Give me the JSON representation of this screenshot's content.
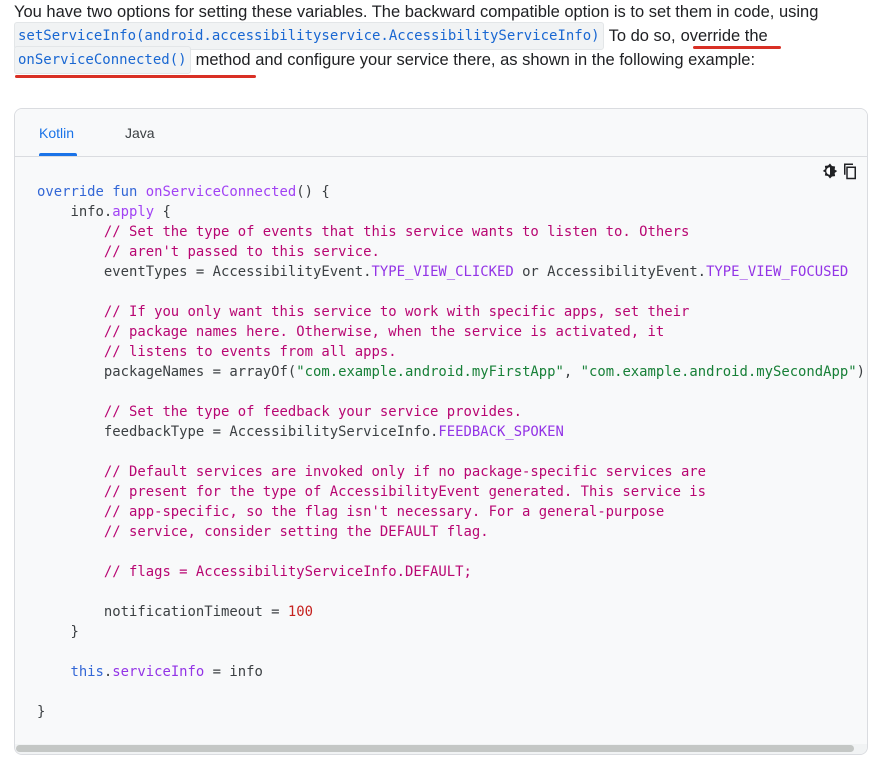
{
  "intro": {
    "line1": "You have two options for setting these variables. The backward compatible option is to set them in code, using",
    "code1": "setServiceInfo(android.accessibilityservice.AccessibilityServiceInfo)",
    "after_code1": "To do so,",
    "link_text": "override the",
    "code2": "onServiceConnected()",
    "after_code2": "method and configure your service there, as shown in the following example:"
  },
  "tabs": [
    {
      "label": "Kotlin",
      "active": true
    },
    {
      "label": "Java",
      "active": false
    }
  ],
  "icons": [
    "brightness-icon",
    "copy-icon"
  ],
  "code": {
    "l1_kw": "override fun",
    "l1_fn": "onServiceConnected",
    "l1_rest": "() {",
    "l2_obj": "info",
    "l2_dot": ".",
    "l2_fn": "apply",
    "l2_rest": " {",
    "l3": "// Set the type of events that this service wants to listen to. Others",
    "l4": "// aren't passed to this service.",
    "l5_a": "eventTypes = AccessibilityEvent.",
    "l5_c1": "TYPE_VIEW_CLICKED",
    "l5_or": " or AccessibilityEvent.",
    "l5_c2": "TYPE_VIEW_FOCUSED",
    "l7": "// If you only want this service to work with specific apps, set their",
    "l8": "// package names here. Otherwise, when the service is activated, it",
    "l9": "// listens to events from all apps.",
    "l10_a": "packageNames = arrayOf(",
    "l10_s1": "\"com.example.android.myFirstApp\"",
    "l10_comma": ", ",
    "l10_s2": "\"com.example.android.mySecondApp\"",
    "l10_end": ")",
    "l12": "// Set the type of feedback your service provides.",
    "l13_a": "feedbackType = AccessibilityServiceInfo.",
    "l13_c": "FEEDBACK_SPOKEN",
    "l15": "// Default services are invoked only if no package-specific services are",
    "l16": "// present for the type of AccessibilityEvent generated. This service is",
    "l17": "// app-specific, so the flag isn't necessary. For a general-purpose",
    "l18": "// service, consider setting the DEFAULT flag.",
    "l20": "// flags = AccessibilityServiceInfo.DEFAULT;",
    "l22_a": "notificationTimeout = ",
    "l22_n": "100",
    "l23": "}",
    "l25_kw": "this",
    "l25_dot": ".",
    "l25_prop": "serviceInfo",
    "l25_rest": " = info",
    "l27": "}"
  },
  "colors": {
    "accent": "#1a73e8",
    "underline_red": "#d93025",
    "comment": "#b80672",
    "string": "#188038",
    "keyword": "#3367d6"
  }
}
